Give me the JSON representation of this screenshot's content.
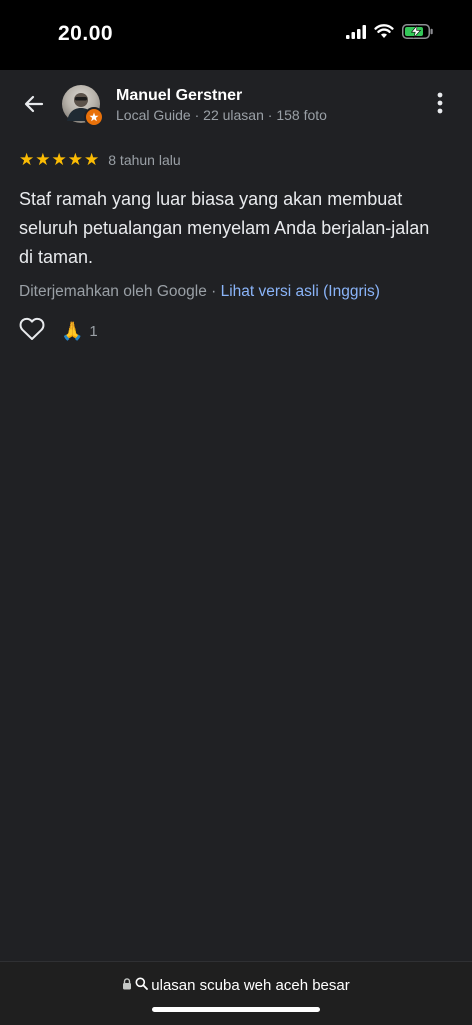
{
  "status_bar": {
    "time": "20.00",
    "icons": [
      "signal-icon",
      "wifi-icon",
      "battery-charging-icon"
    ]
  },
  "header": {
    "user_name": "Manuel Gerstner",
    "user_meta": "Local Guide · 22 ulasan · 158 foto",
    "icons": [
      "back-arrow-icon",
      "more-vert-icon"
    ],
    "badge_color": "#e8710a"
  },
  "review": {
    "rating": 5,
    "rating_max": 5,
    "star_color": "#fbbc04",
    "time": "8 tahun lalu",
    "text": "Staf ramah yang luar biasa yang akan membuat seluruh petualangan menyelam Anda berjalan-jalan di taman.",
    "translation_note": "Diterjemahkan oleh Google · ",
    "translation_link": "Lihat versi asli (Inggris)",
    "link_color": "#8ab4f8"
  },
  "reactions": {
    "emoji": "🙏",
    "count": "1"
  },
  "url_bar": {
    "text": "ulasan scuba weh aceh besar",
    "icons": [
      "lock-icon",
      "search-icon"
    ]
  }
}
